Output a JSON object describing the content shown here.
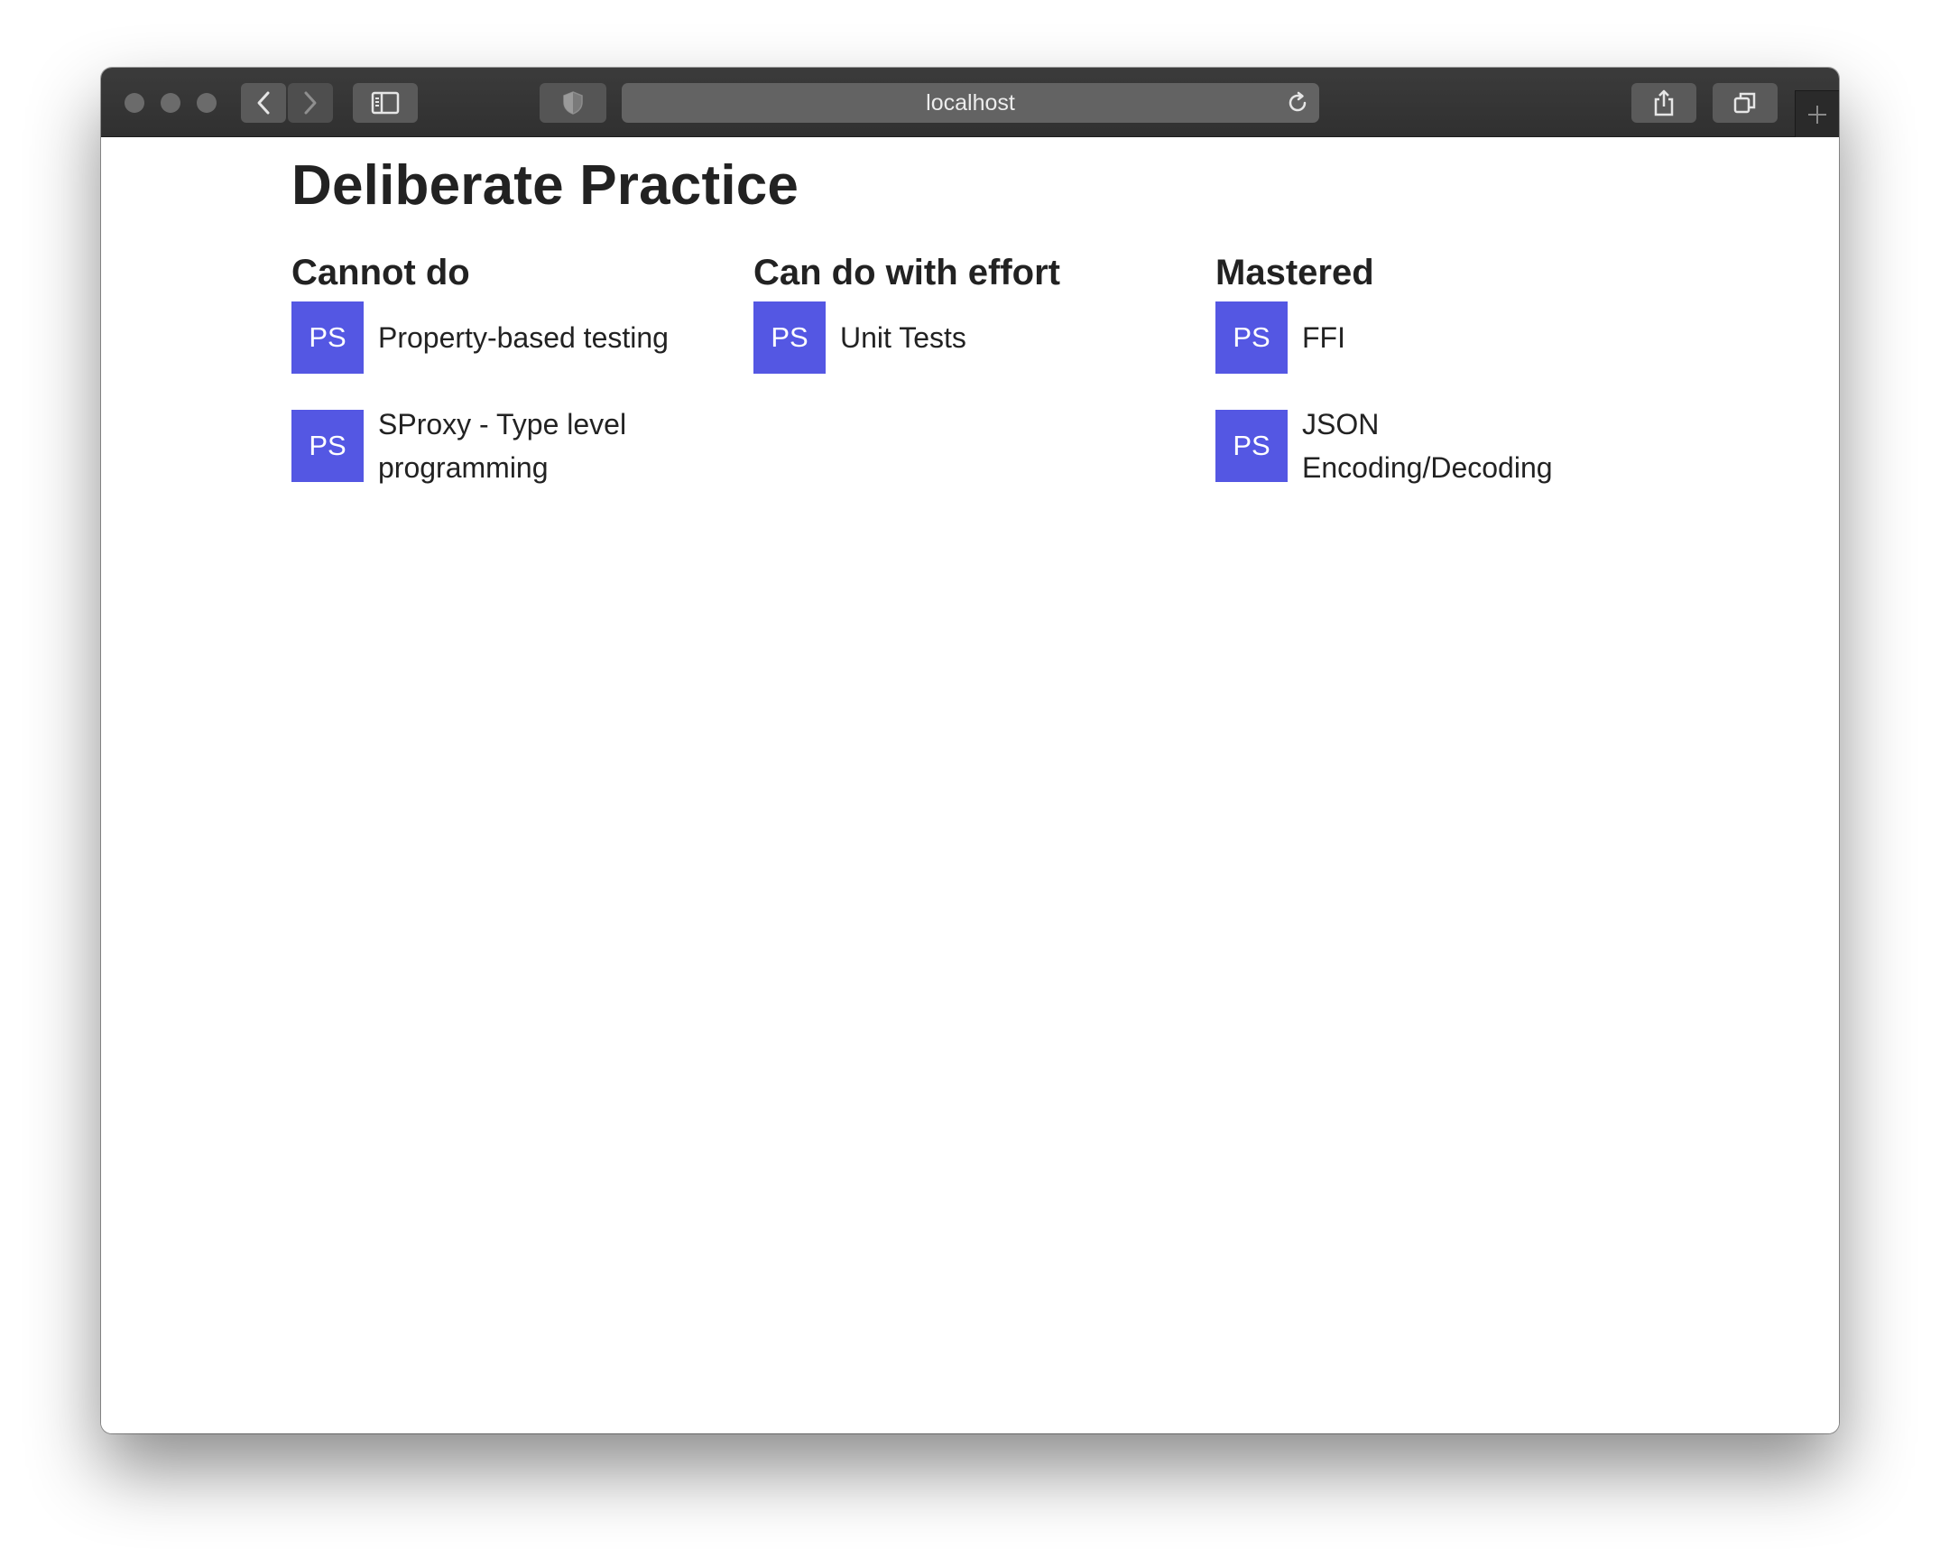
{
  "browser": {
    "url": "localhost",
    "icons": {
      "back": "chevron-left-icon",
      "forward": "chevron-right-icon",
      "sidebar": "sidebar-icon",
      "privacy": "shield-icon",
      "reload": "reload-icon",
      "share": "share-icon",
      "tabs": "tabs-icon",
      "new_tab": "plus-icon"
    }
  },
  "page": {
    "title": "Deliberate Practice",
    "columns": [
      {
        "title": "Cannot do",
        "items": [
          {
            "badge": "PS",
            "label": "Property-based testing"
          },
          {
            "badge": "PS",
            "label": "SProxy - Type level programming"
          }
        ]
      },
      {
        "title": "Can do with effort",
        "items": [
          {
            "badge": "PS",
            "label": "Unit Tests"
          }
        ]
      },
      {
        "title": "Mastered",
        "items": [
          {
            "badge": "PS",
            "label": "FFI"
          },
          {
            "badge": "PS",
            "label": "JSON Encoding/Decoding"
          }
        ]
      }
    ]
  },
  "colors": {
    "badge": "#5457e3",
    "text": "#222222",
    "titlebar": "#333333"
  }
}
